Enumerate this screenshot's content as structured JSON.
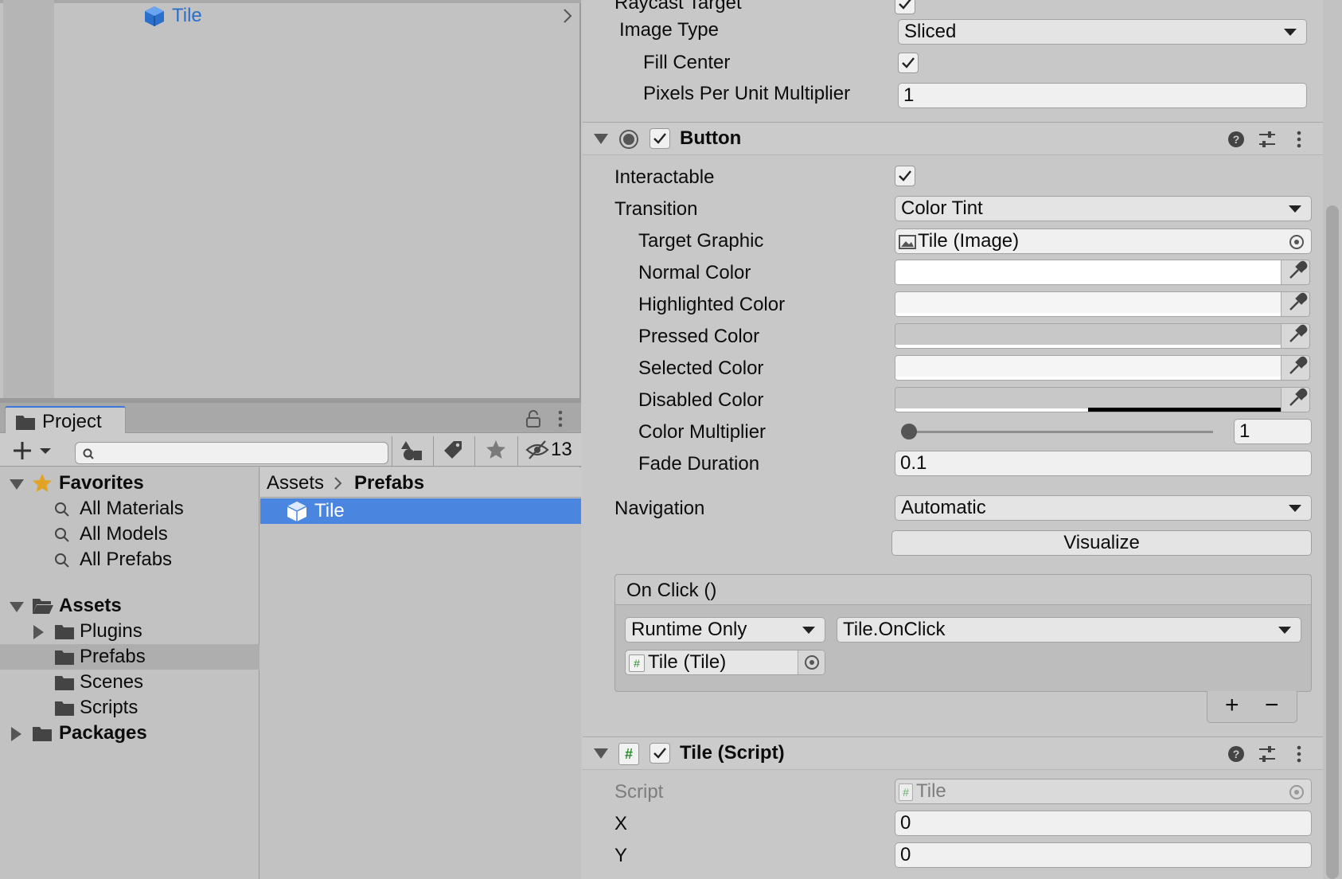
{
  "hierarchy": {
    "item_label": "Tile",
    "item_color": "#2a6fc9"
  },
  "project": {
    "tab_label": "Project",
    "hidden_count": "13",
    "favorites": {
      "title": "Favorites",
      "items": [
        "All Materials",
        "All Models",
        "All Prefabs"
      ]
    },
    "assets": {
      "title": "Assets",
      "children": [
        "Plugins",
        "Prefabs",
        "Scenes",
        "Scripts"
      ],
      "selected": "Prefabs"
    },
    "packages_title": "Packages",
    "breadcrumb": {
      "root": "Assets",
      "current": "Prefabs"
    },
    "files": [
      {
        "name": "Tile",
        "selected": true
      }
    ],
    "selection_color": "#4a86e0"
  },
  "inspector": {
    "image": {
      "raycast_target_label": "Raycast Target",
      "image_type_label": "Image Type",
      "image_type_value": "Sliced",
      "fill_center_label": "Fill Center",
      "ppu_label": "Pixels Per Unit Multiplier",
      "ppu_value": "1"
    },
    "button": {
      "title": "Button",
      "interactable_label": "Interactable",
      "transition_label": "Transition",
      "transition_value": "Color Tint",
      "target_graphic_label": "Target Graphic",
      "target_graphic_value": "Tile (Image)",
      "normal_color_label": "Normal Color",
      "highlighted_color_label": "Highlighted Color",
      "pressed_color_label": "Pressed Color",
      "selected_color_label": "Selected Color",
      "disabled_color_label": "Disabled Color",
      "color_multiplier_label": "Color Multiplier",
      "color_multiplier_value": "1",
      "color_multiplier_fraction": 0,
      "fade_duration_label": "Fade Duration",
      "fade_duration_value": "0.1",
      "navigation_label": "Navigation",
      "navigation_value": "Automatic",
      "visualize_label": "Visualize",
      "colors": {
        "normal": "#ffffff",
        "highlighted": "#f5f5f5",
        "pressed": "#c8c8c8",
        "selected": "#f5f5f5",
        "disabled": "#c8c8c8"
      },
      "disabled_alpha_fraction": 0.5
    },
    "onclick": {
      "title": "On Click ()",
      "runtime_value": "Runtime Only",
      "function_value": "Tile.OnClick",
      "object_value": "Tile (Tile)",
      "add_label": "+",
      "remove_label": "−"
    },
    "tile_script": {
      "title": "Tile (Script)",
      "script_label": "Script",
      "script_value": "Tile",
      "x_label": "X",
      "x_value": "0",
      "y_label": "Y",
      "y_value": "0"
    }
  }
}
